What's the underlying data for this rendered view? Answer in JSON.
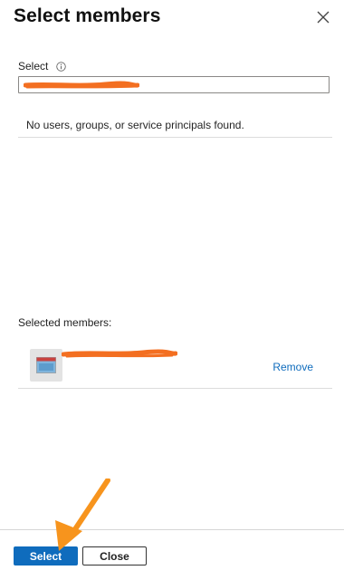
{
  "panel": {
    "title": "Select members"
  },
  "search": {
    "label": "Select",
    "value": "",
    "no_results_text": "No users, groups, or service principals found."
  },
  "selected": {
    "label": "Selected members:",
    "members": [
      {
        "name": "",
        "remove_label": "Remove"
      }
    ]
  },
  "footer": {
    "select_label": "Select",
    "close_label": "Close"
  },
  "icons": {
    "close": "close-icon",
    "info": "info-icon",
    "member": "app-icon"
  },
  "colors": {
    "accent": "#0f6cbd",
    "annotation": "#f7941d",
    "redaction": "#f36f21"
  }
}
